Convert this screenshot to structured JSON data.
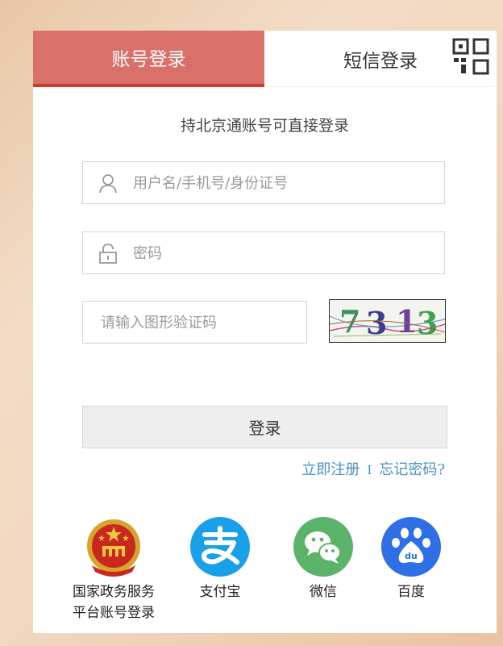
{
  "tabs": {
    "account": "账号登录",
    "sms": "短信登录"
  },
  "tagline": "持北京通账号可直接登录",
  "username": {
    "placeholder": "用户名/手机号/身份证号"
  },
  "password": {
    "placeholder": "密码"
  },
  "captcha": {
    "placeholder": "请输入图形验证码",
    "code": [
      "7",
      "3",
      "1",
      "3"
    ]
  },
  "login_button": "登录",
  "links": {
    "register": "立即注册",
    "separator": "I",
    "forgot": "忘记密码?"
  },
  "oauth": [
    {
      "line1": "国家政务服务",
      "line2": "平台账号登录"
    },
    {
      "line1": "支付宝"
    },
    {
      "line1": "微信"
    },
    {
      "line1": "百度"
    }
  ],
  "colors": {
    "accent": "#d9706a",
    "accent_border": "#d13a26",
    "link": "#4a90c8",
    "alipay": "#1aa0e8",
    "wechat": "#5bb36a",
    "baidu": "#2e6fe6"
  }
}
